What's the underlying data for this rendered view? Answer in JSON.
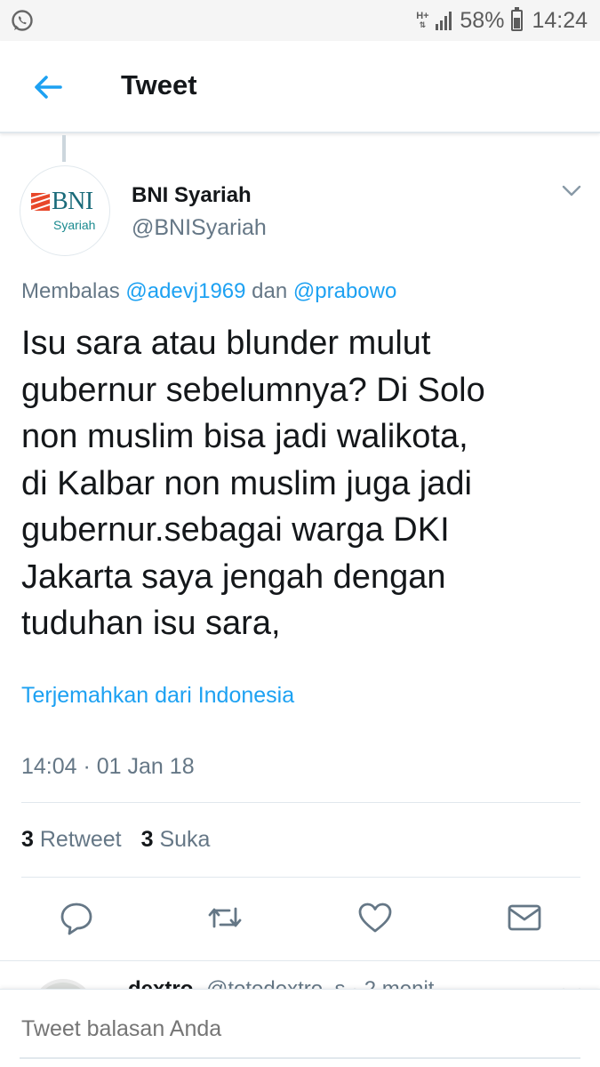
{
  "status_bar": {
    "network_type": "H+",
    "battery": "58%",
    "battery_level": 0.58,
    "time": "14:24",
    "icons": [
      "whatsapp-icon",
      "signal-icon",
      "battery-icon"
    ]
  },
  "header": {
    "title": "Tweet",
    "back_icon": "arrow-left-icon"
  },
  "tweet": {
    "author": {
      "name": "BNI Syariah",
      "handle": "@BNISyariah",
      "avatar_logo": {
        "brand": "BNI",
        "sub": "Syariah"
      }
    },
    "reply_to": {
      "prefix": "Membalas ",
      "mention_1": "@adevj1969",
      "joiner": " dan ",
      "mention_2": "@prabowo"
    },
    "text_lines": [
      "Isu sara atau blunder mulut",
      "gubernur sebelumnya? Di Solo",
      "non muslim bisa jadi walikota,",
      "di Kalbar non muslim juga jadi",
      "gubernur.sebagai warga DKI",
      "Jakarta saya jengah dengan",
      "tuduhan isu sara,"
    ],
    "translate": "Terjemahkan dari Indonesia",
    "timestamp": "14:04 · 01 Jan 18",
    "stats": {
      "retweets_count": "3",
      "retweets_label": "Retweet",
      "likes_count": "3",
      "likes_label": "Suka"
    },
    "actions": [
      "reply-icon",
      "retweet-icon",
      "like-icon",
      "direct-message-icon"
    ]
  },
  "next_reply": {
    "name": "dextro",
    "meta": "@totodextro_s · 2 menit"
  },
  "composer": {
    "placeholder": "Tweet balasan Anda"
  },
  "colors": {
    "accent": "#1da1f2",
    "secondary_text": "#657786",
    "primary_text": "#14171a",
    "divider": "#e1e8ed",
    "logo_red": "#e8472a",
    "logo_teal": "#1a6b7a"
  }
}
